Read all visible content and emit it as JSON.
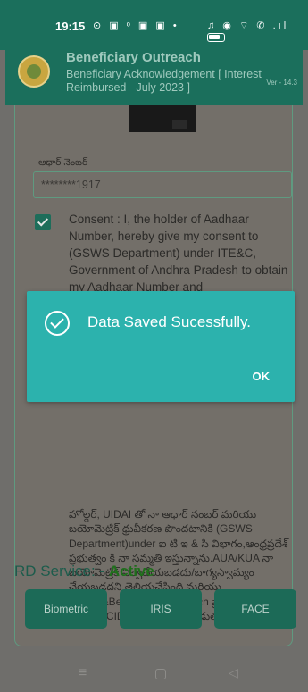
{
  "status_bar": {
    "time": "19:15",
    "left_icons": "⊙ ▣ ᵒ ▣ ▣ •",
    "right_icons": "♫ ◉ ⌔ ✆ .ıl"
  },
  "app": {
    "title": "Beneficiary Outreach",
    "subtitle": "Beneficiary Acknowledgement [ Interest Reimbursed - July 2023 ]",
    "version": "Ver - 14.3"
  },
  "form": {
    "aadhaar_label": "ఆధార్ నెంబర్",
    "aadhaar_value": "********1917",
    "consent_checked": true,
    "consent_english": "Consent : I, the holder of Aadhaar Number, hereby give my consent to (GSWS Department) under ITE&C, Government of Andhra Pradesh to obtain my Aadhaar Number and",
    "consent_telugu": "హోల్డర్, UIDAI తో నా ఆధార్ నంబర్ మరియు బయోమెట్రిక్ ధ్రువీకరణ పొందటానికి (GSWS Department)under ఐ టి ఇ & సి విభాగం,ఆంధ్రప్రదేశ్ ప్రభుత్వం కి నా సమ్మతి ఇస్తున్నాను.AUA/KUA నా బయోమెట్రిక్ నిల్వచేయబడదు/బాగ్యస్వామ్యం చేయబడదని తెలియచేసింది మరియు Citizen&Beneficiary Outreach ప్రామాణీకరణ కొరకు మాత్రమే CIDR కు సమర్పించబడుతుంది.",
    "rd_service_label": "RD Service: -",
    "rd_service_status": "Active",
    "buttons": {
      "biometric": "Biometric",
      "iris": "IRIS",
      "face": "FACE"
    }
  },
  "dialog": {
    "message": "Data Saved Sucessfully.",
    "ok_label": "OK"
  },
  "nav": {
    "menu": "≡",
    "back": "◁"
  },
  "colors": {
    "header": "#1b6f5c",
    "dialog": "#2cb2ad",
    "overlay": "#6f6e6b",
    "active": "#1f6e1c"
  }
}
